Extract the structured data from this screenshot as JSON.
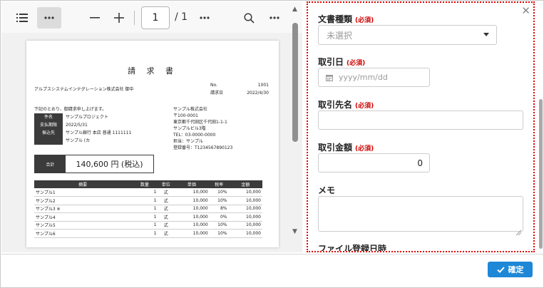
{
  "viewer": {
    "page_current": "1",
    "page_total": "/ 1",
    "icons": [
      "list-icon",
      "more-icon",
      "zoom-out-icon",
      "zoom-in-icon",
      "more-icon",
      "search-icon",
      "more-icon"
    ]
  },
  "document": {
    "title": "請 求 書",
    "recipient": "アルプスシステムインテグレーション株式会社 御中",
    "no_label": "No.",
    "no_value": "1001",
    "date_label": "請求日",
    "date_value": "2022/4/30",
    "intro": "下記のとおり、御請求申し上げます。",
    "info": [
      {
        "label": "件名",
        "value": "サンプルプロジェクト"
      },
      {
        "label": "支払期限",
        "value": "2022/5/31"
      },
      {
        "label": "振込先",
        "value": "サンプル銀行 本店 普通 1111111"
      },
      {
        "label": "",
        "value": "サンプル (カ"
      }
    ],
    "sender": [
      "サンプル株式会社",
      "〒100-0001",
      "東京都千代田区千代田1-1-1",
      "サンプルビル3階",
      "TEL：03-0000-0000",
      "担当：サンプル",
      "登録番号：T1234567890123"
    ],
    "total_label": "合計",
    "total_value": "140,600 円 (税込)",
    "table_headers": [
      "摘要",
      "数量",
      "単位",
      "単価",
      "税率",
      "金額"
    ],
    "table_rows": [
      [
        "サンプル1",
        "1",
        "式",
        "10,000",
        "10%",
        "10,000"
      ],
      [
        "サンプル2",
        "1",
        "式",
        "10,000",
        "10%",
        "10,000"
      ],
      [
        "サンプル3 ※",
        "1",
        "式",
        "10,000",
        "8%",
        "10,000"
      ],
      [
        "サンプル4",
        "1",
        "式",
        "10,000",
        "0%",
        "10,000"
      ],
      [
        "サンプル5",
        "1",
        "式",
        "10,000",
        "10%",
        "10,000"
      ],
      [
        "サンプル6",
        "1",
        "式",
        "10,000",
        "10%",
        "10,000"
      ]
    ]
  },
  "form": {
    "doc_type_label": "文書種類",
    "doc_type_required": "(必須)",
    "doc_type_value": "未選択",
    "txn_date_label": "取引日",
    "txn_date_required": "(必須)",
    "txn_date_placeholder": "yyyy/mm/dd",
    "partner_label": "取引先名",
    "partner_required": "(必須)",
    "partner_value": "",
    "amount_label": "取引金額",
    "amount_required": "(必須)",
    "amount_value": "0",
    "memo_label": "メモ",
    "memo_value": "",
    "registered_label": "ファイル登録日時"
  },
  "footer": {
    "confirm_label": "確定"
  },
  "colors": {
    "accent": "#1e88d6",
    "required": "#d00000",
    "highlight_border": "#e00000"
  }
}
